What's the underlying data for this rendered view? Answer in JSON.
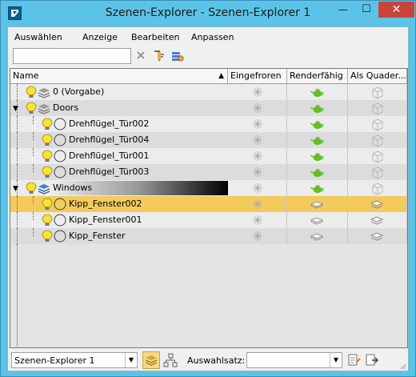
{
  "window": {
    "title": "Szenen-Explorer - Szenen-Explorer 1",
    "min_glyph": "—",
    "max_glyph": "☐",
    "close_glyph": "✕"
  },
  "menu": [
    "Auswählen",
    "Anzeige",
    "Bearbeiten",
    "Anpassen"
  ],
  "search": {
    "value": "",
    "placeholder": ""
  },
  "columns": {
    "name": "Name",
    "frozen": "Eingefroren",
    "renderable": "Renderfähig",
    "box": "Als Quader..."
  },
  "rows": [
    {
      "label": "0 (Vorgabe)",
      "type": "layer",
      "level": 0,
      "expander": "none"
    },
    {
      "label": "Doors",
      "type": "layer",
      "level": 0,
      "expander": "open"
    },
    {
      "label": "Drehflügel_Tür002",
      "type": "object",
      "level": 1
    },
    {
      "label": "Drehflügel_Tür004",
      "type": "object",
      "level": 1
    },
    {
      "label": "Drehflügel_Tür001",
      "type": "object",
      "level": 1
    },
    {
      "label": "Drehflügel_Tür003",
      "type": "object",
      "level": 1
    },
    {
      "label": "Windows",
      "type": "layer-active",
      "level": 0,
      "expander": "open"
    },
    {
      "label": "Kipp_Fenster002",
      "type": "object",
      "level": 1,
      "selected": true
    },
    {
      "label": "Kipp_Fenster001",
      "type": "object",
      "level": 1
    },
    {
      "label": "Kipp_Fenster",
      "type": "object",
      "level": 1
    }
  ],
  "footer": {
    "explorer_select": "Szenen-Explorer 1",
    "selection_label": "Auswahlsatz:",
    "selection_value": ""
  },
  "colors": {
    "titlebar": "#5cc3e8",
    "close": "#c7443a",
    "selection": "#f2cb5c",
    "teapot": "#6ab82e"
  }
}
